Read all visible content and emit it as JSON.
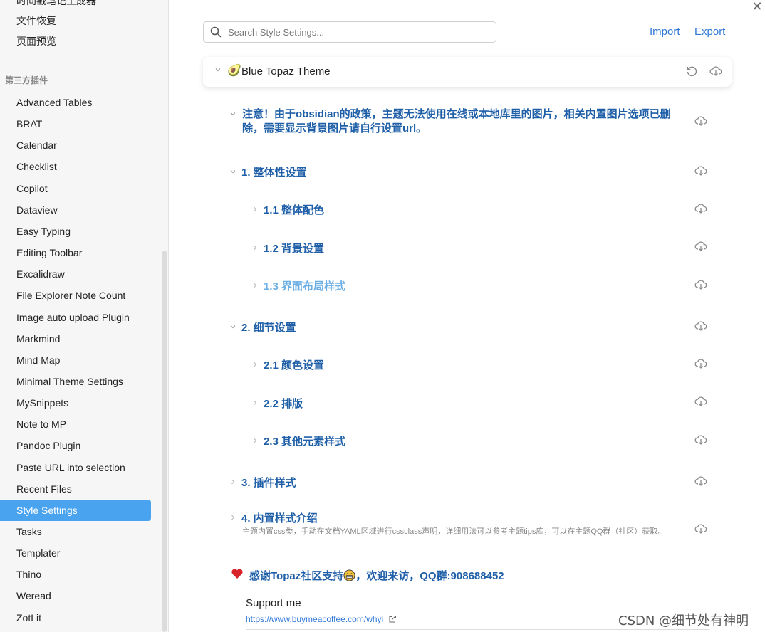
{
  "sidebar": {
    "cut_item": "时间戳笔记生成器",
    "core_items": [
      "文件恢复",
      "页面预览"
    ],
    "group_label": "第三方插件",
    "plugins": [
      "Advanced Tables",
      "BRAT",
      "Calendar",
      "Checklist",
      "Copilot",
      "Dataview",
      "Easy Typing",
      "Editing Toolbar",
      "Excalidraw",
      "File Explorer Note Count",
      "Image auto upload Plugin",
      "Markmind",
      "Mind Map",
      "Minimal Theme Settings",
      "MySnippets",
      "Note to MP",
      "Pandoc Plugin",
      "Paste URL into selection",
      "Recent Files",
      "Style Settings",
      "Tasks",
      "Templater",
      "Thino",
      "Weread",
      "ZotLit"
    ],
    "active": "Style Settings",
    "accent_color": "#4aa3ef"
  },
  "header": {
    "close_symbol": "✕",
    "search_placeholder": "Search Style Settings...",
    "import_label": "Import",
    "export_label": "Export"
  },
  "theme": {
    "emoji": "🥑",
    "title": "Blue Topaz Theme"
  },
  "notice": "注意！由于obsidian的政策，主题无法使用在线或本地库里的图片，相关内置图片选项已删除，需要显示背景图片请自行设置url。",
  "sections": [
    {
      "label": "1. 整体性设置",
      "expanded": true,
      "level": 1
    },
    {
      "label": "1.1 整体配色",
      "expanded": false,
      "level": 2
    },
    {
      "label": "1.2 背景设置",
      "expanded": false,
      "level": 2
    },
    {
      "label": "1.3 界面布局样式",
      "expanded": false,
      "level": 2,
      "hovered": true
    },
    {
      "label": "2. 细节设置",
      "expanded": true,
      "level": 1
    },
    {
      "label": "2.1 颜色设置",
      "expanded": false,
      "level": 2
    },
    {
      "label": "2.2 排版",
      "expanded": false,
      "level": 2
    },
    {
      "label": "2.3 其他元素样式",
      "expanded": false,
      "level": 2
    },
    {
      "label": "3. 插件样式",
      "expanded": false,
      "level": 1
    },
    {
      "label": "4. 内置样式介绍",
      "expanded": false,
      "level": 1
    }
  ],
  "section4_desc": "主题内置css类，手动在文档YAML区域进行cssclass声明，详细用法可以参考主题tips库，可以在主题QQ群（社区）获取。",
  "thanks": {
    "before": "感谢Topaz社区支持",
    "after": "，欢迎来访，QQ群:908688452"
  },
  "support": {
    "title": "Support me",
    "url": "https://www.buymeacoffee.com/whyi"
  },
  "watermark": "CSDN @细节处有神明",
  "colors": {
    "heading": "#1f5fa8",
    "heading_hover": "#6aaee6",
    "link": "#2f78d6"
  }
}
